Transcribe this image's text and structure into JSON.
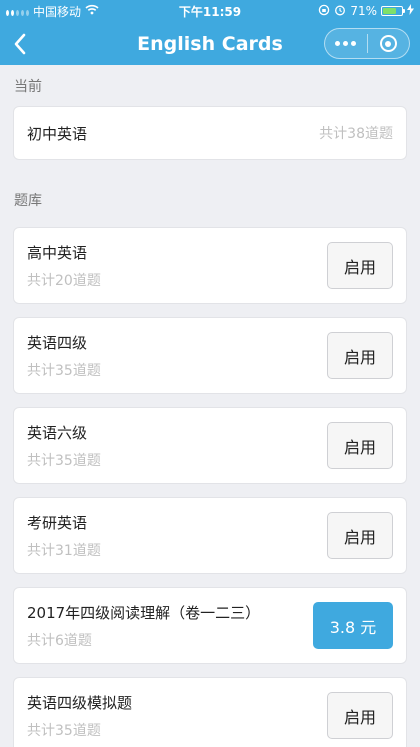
{
  "status_bar": {
    "carrier": "中国移动",
    "time": "下午11:59",
    "battery": "71%",
    "battery_level": 0.71
  },
  "nav": {
    "title": "English Cards"
  },
  "current_section": {
    "header": "当前",
    "item": {
      "name": "初中英语",
      "count": "共计38道题"
    }
  },
  "bank_section": {
    "header": "题库",
    "items": [
      {
        "name": "高中英语",
        "count": "共计20道题",
        "action": "启用"
      },
      {
        "name": "英语四级",
        "count": "共计35道题",
        "action": "启用"
      },
      {
        "name": "英语六级",
        "count": "共计35道题",
        "action": "启用"
      },
      {
        "name": "考研英语",
        "count": "共计31道题",
        "action": "启用"
      },
      {
        "name": "2017年四级阅读理解（卷一二三）",
        "count": "共计6道题",
        "action": "3.8 元"
      },
      {
        "name": "英语四级模拟题",
        "count": "共计35道题",
        "action": "启用"
      }
    ]
  },
  "colors": {
    "accent": "#3fa9df",
    "background": "#eeeff3"
  }
}
